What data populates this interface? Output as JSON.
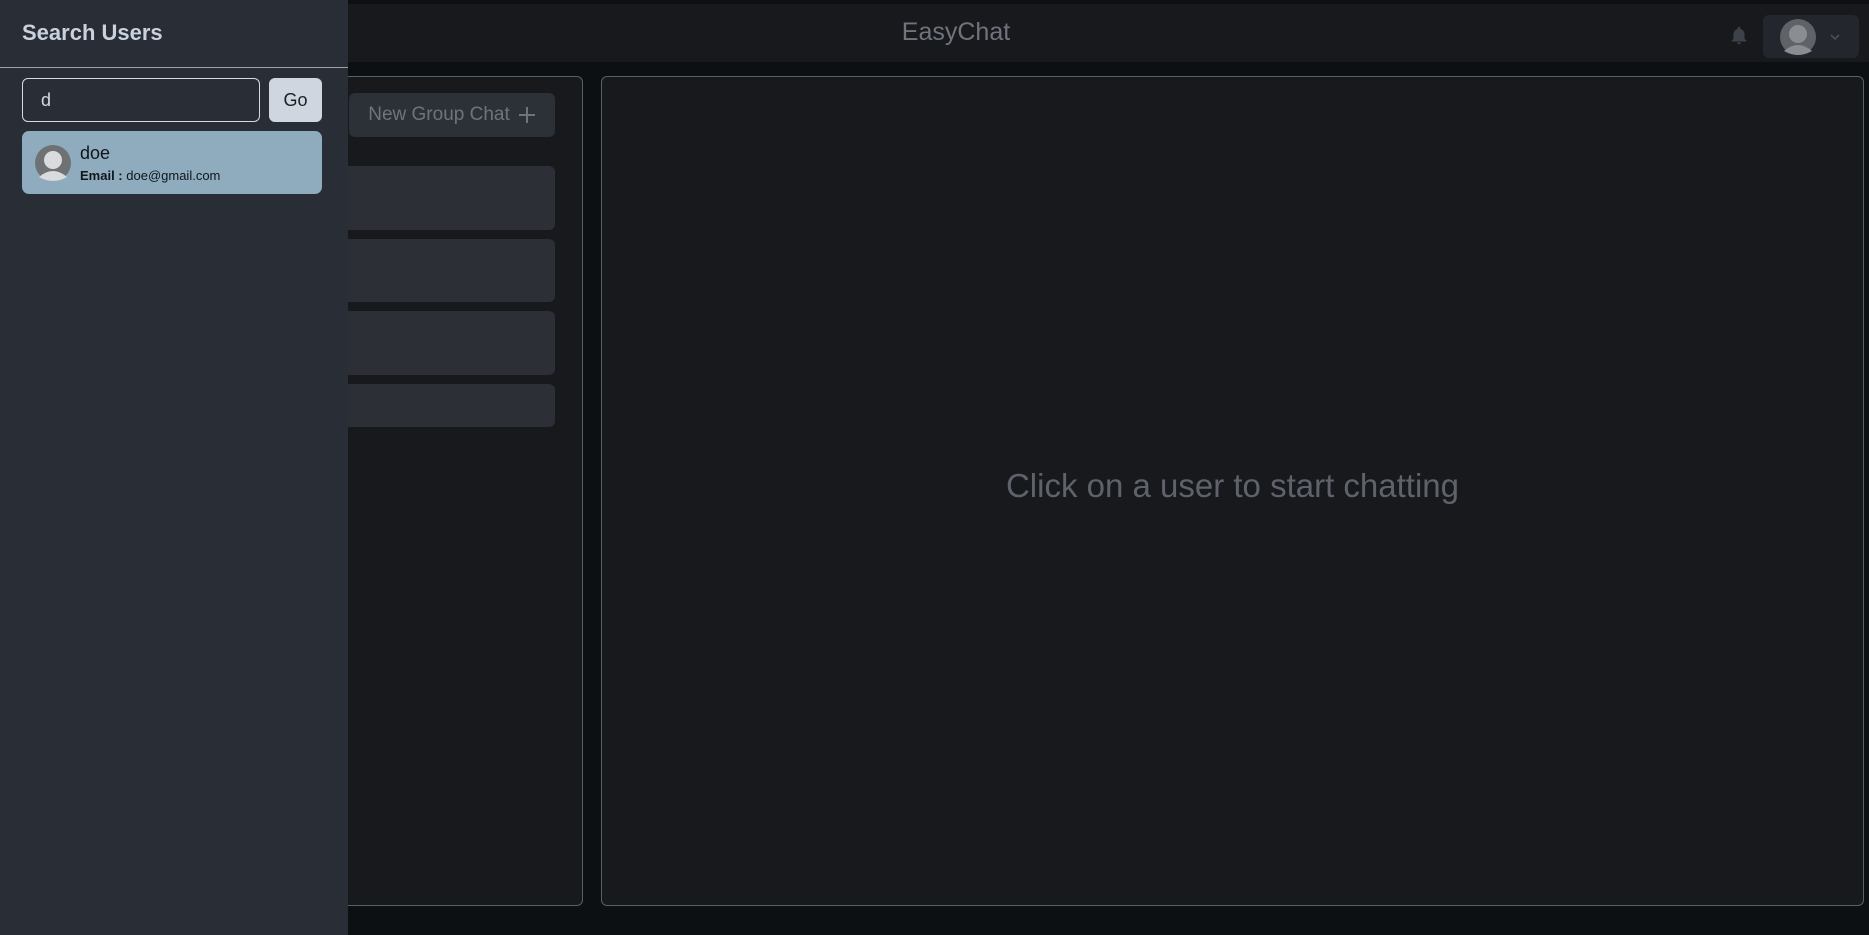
{
  "header": {
    "app_title": "EasyChat",
    "icons": {
      "notifications": "bell-icon",
      "profile": "avatar",
      "menu": "chevron-down-icon"
    }
  },
  "chats_panel": {
    "new_group_label": "New Group Chat",
    "new_group_icon": "plus-icon"
  },
  "chat_box": {
    "empty_message": "Click on a user to start chatting"
  },
  "drawer": {
    "title": "Search Users",
    "search": {
      "value": "d"
    },
    "go_label": "Go",
    "results": [
      {
        "name": "doe",
        "email_label": "Email :",
        "email": "doe@gmail.com"
      }
    ]
  },
  "colors": {
    "background": "#0c1012",
    "panel": "#17191d",
    "drawer": "#282d36",
    "result_highlight": "#8eacbd",
    "button_light": "#cfd6df"
  }
}
